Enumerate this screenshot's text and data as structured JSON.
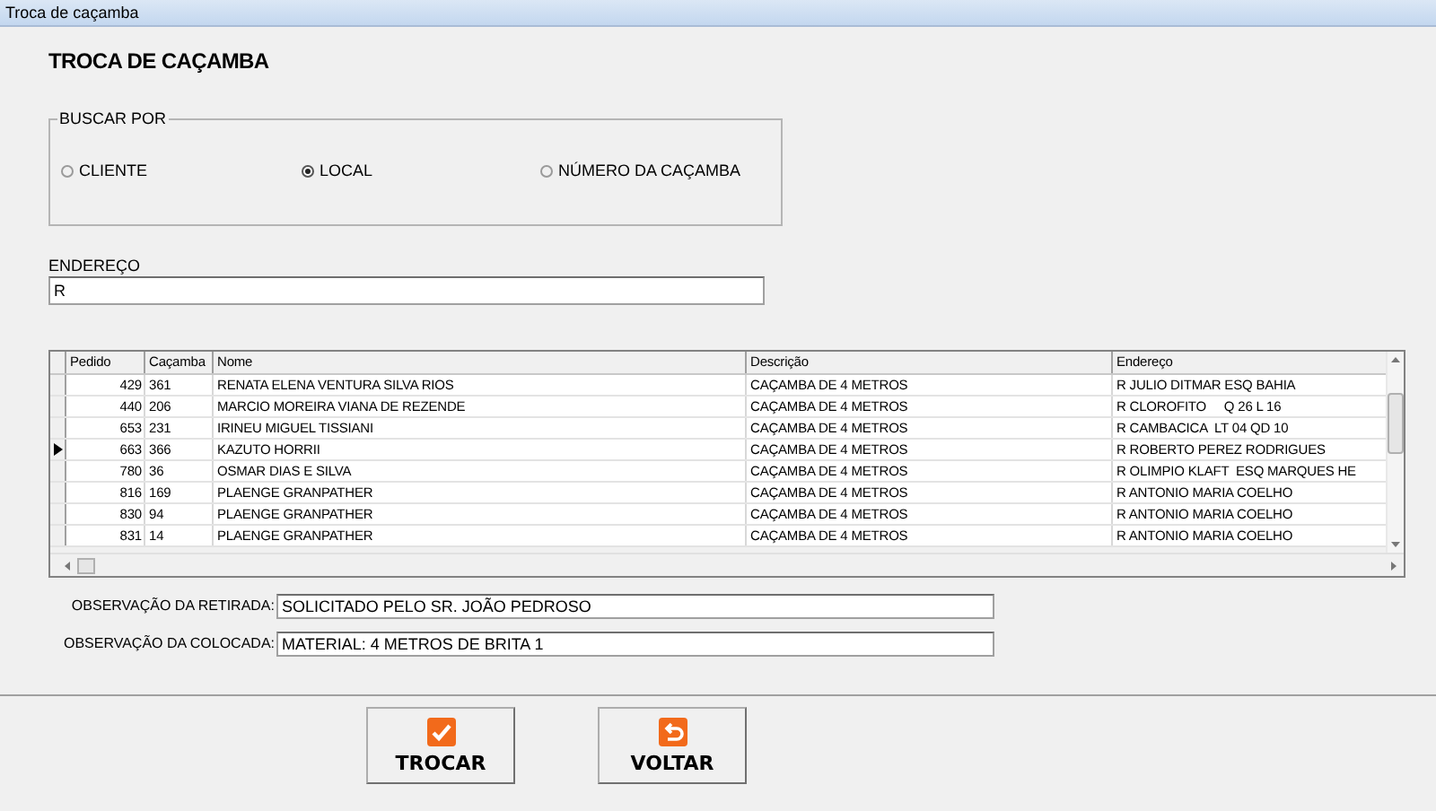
{
  "window": {
    "title": "Troca de caçamba"
  },
  "heading": "TROCA DE CAÇAMBA",
  "search_by": {
    "legend": "BUSCAR POR",
    "options": [
      {
        "label": "CLIENTE",
        "selected": false
      },
      {
        "label": "LOCAL",
        "selected": true
      },
      {
        "label": "NÚMERO DA CAÇAMBA",
        "selected": false
      }
    ]
  },
  "address": {
    "label": "ENDEREÇO",
    "value": "R"
  },
  "table": {
    "columns": [
      "Pedido",
      "Caçamba",
      "Nome",
      "Descrição",
      "Endereço"
    ],
    "rows": [
      {
        "cells": [
          "429",
          "361",
          "RENATA ELENA VENTURA SILVA RIOS",
          "CAÇAMBA DE 4 METROS",
          "R JULIO DITMAR ESQ BAHIA"
        ],
        "selected": false
      },
      {
        "cells": [
          "440",
          "206",
          "MARCIO MOREIRA VIANA DE REZENDE",
          "CAÇAMBA DE 4 METROS",
          "R CLOROFITO     Q 26 L 16"
        ],
        "selected": false
      },
      {
        "cells": [
          "653",
          "231",
          "IRINEU MIGUEL TISSIANI",
          "CAÇAMBA DE 4 METROS",
          "R CAMBACICA  LT 04 QD 10"
        ],
        "selected": false
      },
      {
        "cells": [
          "663",
          "366",
          "KAZUTO HORRII",
          "CAÇAMBA DE 4 METROS",
          "R ROBERTO PEREZ RODRIGUES"
        ],
        "selected": true
      },
      {
        "cells": [
          "780",
          "36",
          "OSMAR DIAS E SILVA",
          "CAÇAMBA DE 4 METROS",
          "R OLIMPIO KLAFT  ESQ MARQUES HE"
        ],
        "selected": false
      },
      {
        "cells": [
          "816",
          "169",
          "PLAENGE GRANPATHER",
          "CAÇAMBA DE 4 METROS",
          "R ANTONIO MARIA COELHO"
        ],
        "selected": false
      },
      {
        "cells": [
          "830",
          "94",
          "PLAENGE GRANPATHER",
          "CAÇAMBA DE 4 METROS",
          "R ANTONIO MARIA COELHO"
        ],
        "selected": false
      },
      {
        "cells": [
          "831",
          "14",
          "PLAENGE GRANPATHER",
          "CAÇAMBA DE 4 METROS",
          "R ANTONIO MARIA COELHO"
        ],
        "selected": false
      }
    ]
  },
  "observations": [
    {
      "label": "OBSERVAÇÃO DA RETIRADA:",
      "value": "SOLICITADO PELO SR. JOÃO PEDROSO"
    },
    {
      "label": "OBSERVAÇÃO DA COLOCADA:",
      "value": "MATERIAL: 4 METROS DE BRITA 1"
    }
  ],
  "buttons": [
    {
      "label": "TROCAR",
      "kind": "confirm"
    },
    {
      "label": "VOLTAR",
      "kind": "back"
    }
  ]
}
